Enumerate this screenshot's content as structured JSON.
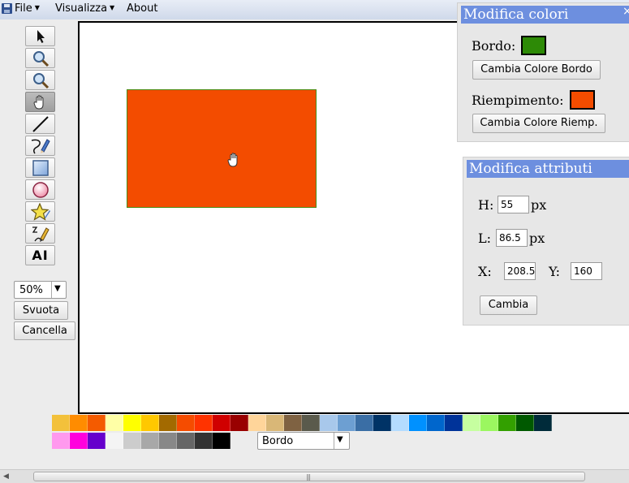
{
  "menubar": {
    "items": [
      {
        "label": "File",
        "has_dropdown": true
      },
      {
        "label": "Visualizza",
        "has_dropdown": true
      },
      {
        "label": "About",
        "has_dropdown": false
      }
    ]
  },
  "toolbar": {
    "tools": [
      {
        "name": "select-tool",
        "icon": "pointer-arrow-icon",
        "active": false
      },
      {
        "name": "zoom-in-tool",
        "icon": "magnifier-icon",
        "active": false
      },
      {
        "name": "zoom-out-tool",
        "icon": "magnifier-icon",
        "active": false
      },
      {
        "name": "pan-tool",
        "icon": "hand-icon",
        "active": true
      },
      {
        "name": "line-tool",
        "icon": "line-icon",
        "active": false
      },
      {
        "name": "freehand-tool",
        "icon": "pen-curve-icon",
        "active": false
      },
      {
        "name": "rectangle-tool",
        "icon": "rectangle-icon",
        "active": false
      },
      {
        "name": "ellipse-tool",
        "icon": "circle-icon",
        "active": false
      },
      {
        "name": "star-tool",
        "icon": "star-icon",
        "active": false
      },
      {
        "name": "path-tool",
        "icon": "pencil-path-icon",
        "active": false
      },
      {
        "name": "text-tool",
        "icon": "text-icon",
        "active": false
      }
    ],
    "text_tool_label": "AI",
    "zoom_value": "50%",
    "svuota_label": "Svuota",
    "cancella_label": "Cancella"
  },
  "canvas": {
    "shape": {
      "type": "rectangle",
      "fill": "#f34c00",
      "stroke": "#4a8a10"
    }
  },
  "color_panel": {
    "title": "Modifica colori",
    "close_label": "×",
    "bordo_label": "Bordo:",
    "bordo_color": "#2d8a06",
    "bordo_button": "Cambia Colore Bordo",
    "fill_label": "Riempimento:",
    "fill_color": "#f34c00",
    "fill_button": "Cambia Colore Riemp."
  },
  "attr_panel": {
    "title": "Modifica attributi",
    "h_label": "H:",
    "h_value": "55",
    "h_unit": "px",
    "l_label": "L:",
    "l_value": "86.5",
    "l_unit": "px",
    "x_label": "X:",
    "x_value": "208.5",
    "y_label": "Y:",
    "y_value": "160",
    "apply_label": "Cambia"
  },
  "palette": {
    "row1": [
      "#f3c13b",
      "#ff8c00",
      "#f45b00",
      "#ffffa6",
      "#ffff00",
      "#ffc800",
      "#a36a00",
      "#f54c00",
      "#ff3300",
      "#d00000",
      "#990000",
      "#ffd59a",
      "#d9b777",
      "#7f6242",
      "#5a5a4c",
      "#a8c8eb",
      "#6d9fd2",
      "#3a6ea5",
      "#003366",
      "#b4dcff",
      "#0091ff",
      "#0066cc",
      "#003399",
      "#c6ffa0",
      "#9bf760",
      "#33a000",
      "#005900",
      "#002b3a"
    ],
    "row2": [
      "#ff99ee",
      "#ff00dd",
      "#6600cc",
      "#f4f4f4",
      "#cccccc",
      "#a8a8a8",
      "#888888",
      "#666666",
      "#333333",
      "#000000"
    ],
    "target_select": "Bordo"
  }
}
